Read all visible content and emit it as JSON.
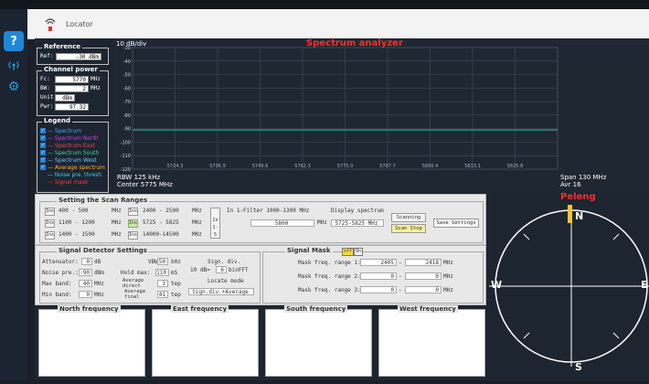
{
  "header": {
    "title": "Locator",
    "icon": "antenna-icon"
  },
  "nav": {
    "icons": [
      "question-icon",
      "signal-icon",
      "settings-icon"
    ]
  },
  "reference": {
    "title": "Reference",
    "ref_label": "Ref:",
    "ref_value": "-30 dBm"
  },
  "channel_power": {
    "title": "Channel power",
    "rows": [
      {
        "label": "Fc:",
        "value": "5770",
        "unit": "MHz"
      },
      {
        "label": "BW:",
        "value": "2",
        "unit": "MHz"
      },
      {
        "label": "Unit:",
        "value": "dBm",
        "unit": ""
      },
      {
        "label": "Pwr:",
        "value": "97.32",
        "unit": ""
      }
    ]
  },
  "legend": {
    "title": "Legend",
    "items": [
      {
        "label": "Spectrum",
        "color": "#42a5ff",
        "checked": true
      },
      {
        "label": "Spectrum North",
        "color": "#d63be6",
        "checked": true
      },
      {
        "label": "Spectrum East",
        "color": "#e64b4b",
        "checked": true
      },
      {
        "label": "Spectrum South",
        "color": "#36d6a0",
        "checked": true
      },
      {
        "label": "Spectrum West",
        "color": "#6ec1ff",
        "checked": true
      },
      {
        "label": "Average spectrum",
        "color": "#ffb02e",
        "checked": true
      },
      {
        "label": "Noise pre. thresh",
        "color": "#3ad0e6",
        "checked": false
      },
      {
        "label": "Signal mask",
        "color": "#ff3b3b",
        "checked": false
      }
    ]
  },
  "chart_data": {
    "type": "line",
    "title": "Spectrum analyzer",
    "scale_label": "10 dB/div",
    "y_ticks": [
      "-30",
      "-40",
      "-50",
      "-60",
      "-70",
      "-80",
      "-90",
      "-100",
      "-110",
      "-120"
    ],
    "x_ticks": [
      "5724.3",
      "5736.9",
      "5749.6",
      "5762.3",
      "5775.0",
      "5787.7",
      "5800.4",
      "5813.1",
      "5825.8"
    ],
    "ylim": [
      -120,
      -30
    ],
    "series": [
      {
        "color": "#3fb7a6",
        "values": [
          -91,
          -91
        ]
      }
    ],
    "rbw": "RBW 125 kHz",
    "center": "Center 5775 MHz",
    "span": "Span 130 MHz",
    "avr": "Avr 16"
  },
  "scan": {
    "title": "Setting the Scan Ranges",
    "ranges": [
      {
        "toggle": "Ins",
        "text": "400 - 500",
        "unit": "MHz",
        "on": false
      },
      {
        "toggle": "Ins",
        "text": "1100 - 1200",
        "unit": "MHz",
        "on": false
      },
      {
        "toggle": "Ins",
        "text": "1400 - 1500",
        "unit": "MHz",
        "on": false
      },
      {
        "toggle": "Ins",
        "text": "2400 - 2500",
        "unit": "MHz",
        "on": false
      },
      {
        "toggle": "Ins",
        "text": "5725 - 5825",
        "unit": "MHz",
        "on": true
      },
      {
        "toggle": "Ins",
        "text": "14000-14500",
        "unit": "MHz",
        "on": false
      }
    ],
    "in_toggle": "In 1-5",
    "filter_label": "In 1-Filter 1000-1300 MHz",
    "filter_value": "5800",
    "filter_unit": "MHz",
    "display_label": "Display spectrum",
    "display_value": "5725-5825 MHz",
    "scanning_button": "Scanning",
    "scan_stop_button": "Scan Stop",
    "save_button": "Save Settings"
  },
  "detector": {
    "title": "Signal Detector Settings",
    "attenuator_label": "Attenuator:",
    "attenuator_value": "0",
    "attenuator_unit": "dB",
    "vbw_label": "VBW:",
    "vbw_value": "50",
    "vbw_unit": "kHz",
    "sign_div_label": "Sign. div.",
    "noise_label": "Noise pre.:",
    "noise_value": "-90",
    "noise_unit": "dBm",
    "hold_label": "Hold max:",
    "hold_value": "110",
    "hold_unit": "mS",
    "db_value": "10",
    "db_unit": "dB=",
    "bin_value": "6",
    "bin_unit": "binFFT",
    "maxband_label": "Max band:",
    "maxband_value": "40",
    "maxband_unit": "MHz",
    "avg_direct_label": "Average direct",
    "avg_direct_value": "3",
    "avg_direct_unit": "tep",
    "locate_label": "Locate mode",
    "minband_label": "Min band:",
    "minband_value": "0",
    "minband_unit": "MHz",
    "avg_final_label": "Average final",
    "avg_final_value": "41",
    "avg_final_unit": "tep",
    "locate_value": "Sign.div.+Average"
  },
  "mask": {
    "title": "Signal Mask",
    "off_label": "off",
    "on_label": "On",
    "rows": [
      {
        "label": "Mask freq. range 1:",
        "from": "2405",
        "to": "2418",
        "unit": "MHz"
      },
      {
        "label": "Mask freq. range 2:",
        "from": "0",
        "to": "0",
        "unit": "MHz"
      },
      {
        "label": "Mask freq. range 3:",
        "from": "0",
        "to": "0",
        "unit": "MHz"
      }
    ]
  },
  "freq_boxes": [
    "North frequency",
    "East frequency",
    "South frequency",
    "West frequency"
  ],
  "compass": {
    "title": "Peleng",
    "n": "N",
    "e": "E",
    "s": "S",
    "w": "W",
    "bearing_deg": 0
  }
}
